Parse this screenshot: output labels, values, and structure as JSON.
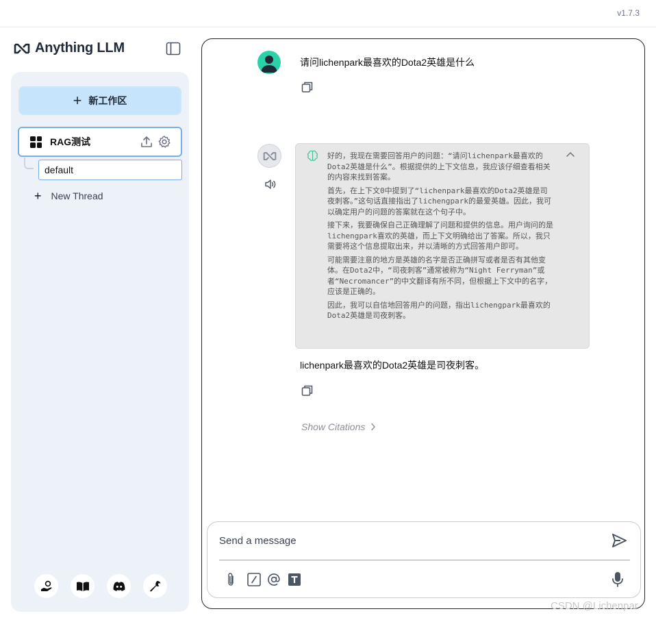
{
  "app": {
    "version": "v1.7.3",
    "brand": "Anything LLM"
  },
  "sidebar": {
    "new_workspace_label": "新工作区",
    "workspace": {
      "name": "RAG测试"
    },
    "thread": {
      "name": "default"
    },
    "new_thread_label": "New Thread",
    "footer_icons": [
      "community-hub-icon",
      "docs-book-icon",
      "discord-icon",
      "settings-wrench-icon"
    ]
  },
  "chat": {
    "user_message": "请问lichenpark最喜欢的Dota2英雄是什么",
    "thoughts": [
      "好的，我现在需要回答用户的问题：“请问lichenpark最喜欢的Dota2英雄是什么”。根据提供的上下文信息，我应该仔细查看相关的内容来找到答案。",
      "首先，在上下文0中提到了“lichenpark最喜欢的Dota2英雄是司夜刺客。”这句话直接指出了lichengpark的最爱英雄。因此，我可以确定用户的问题的答案就在这个句子中。",
      "接下来，我要确保自己正确理解了问题和提供的信息。用户询问的是lichengpark喜欢的英雄，而上下文明确给出了答案。所以，我只需要将这个信息提取出来，并以清晰的方式回答用户即可。",
      "可能需要注意的地方是英雄的名字是否正确拼写或者是否有其他变体。在Dota2中，“司夜刺客”通常被称为“Night Ferryman”或者“Necromancer”的中文翻译有所不同，但根据上下文中的名字，应该是正确的。",
      "因此，我可以自信地回答用户的问题，指出lichengpark最喜欢的Dota2英雄是司夜刺客。"
    ],
    "answer": "lichenpark最喜欢的Dota2英雄是司夜刺客。",
    "show_citations_label": "Show Citations"
  },
  "composer": {
    "placeholder": "Send a message",
    "tools": [
      "attach-icon",
      "slash-command-icon",
      "mention-icon",
      "text-size-icon"
    ]
  },
  "watermark": "CSDN @Lichenpar"
}
